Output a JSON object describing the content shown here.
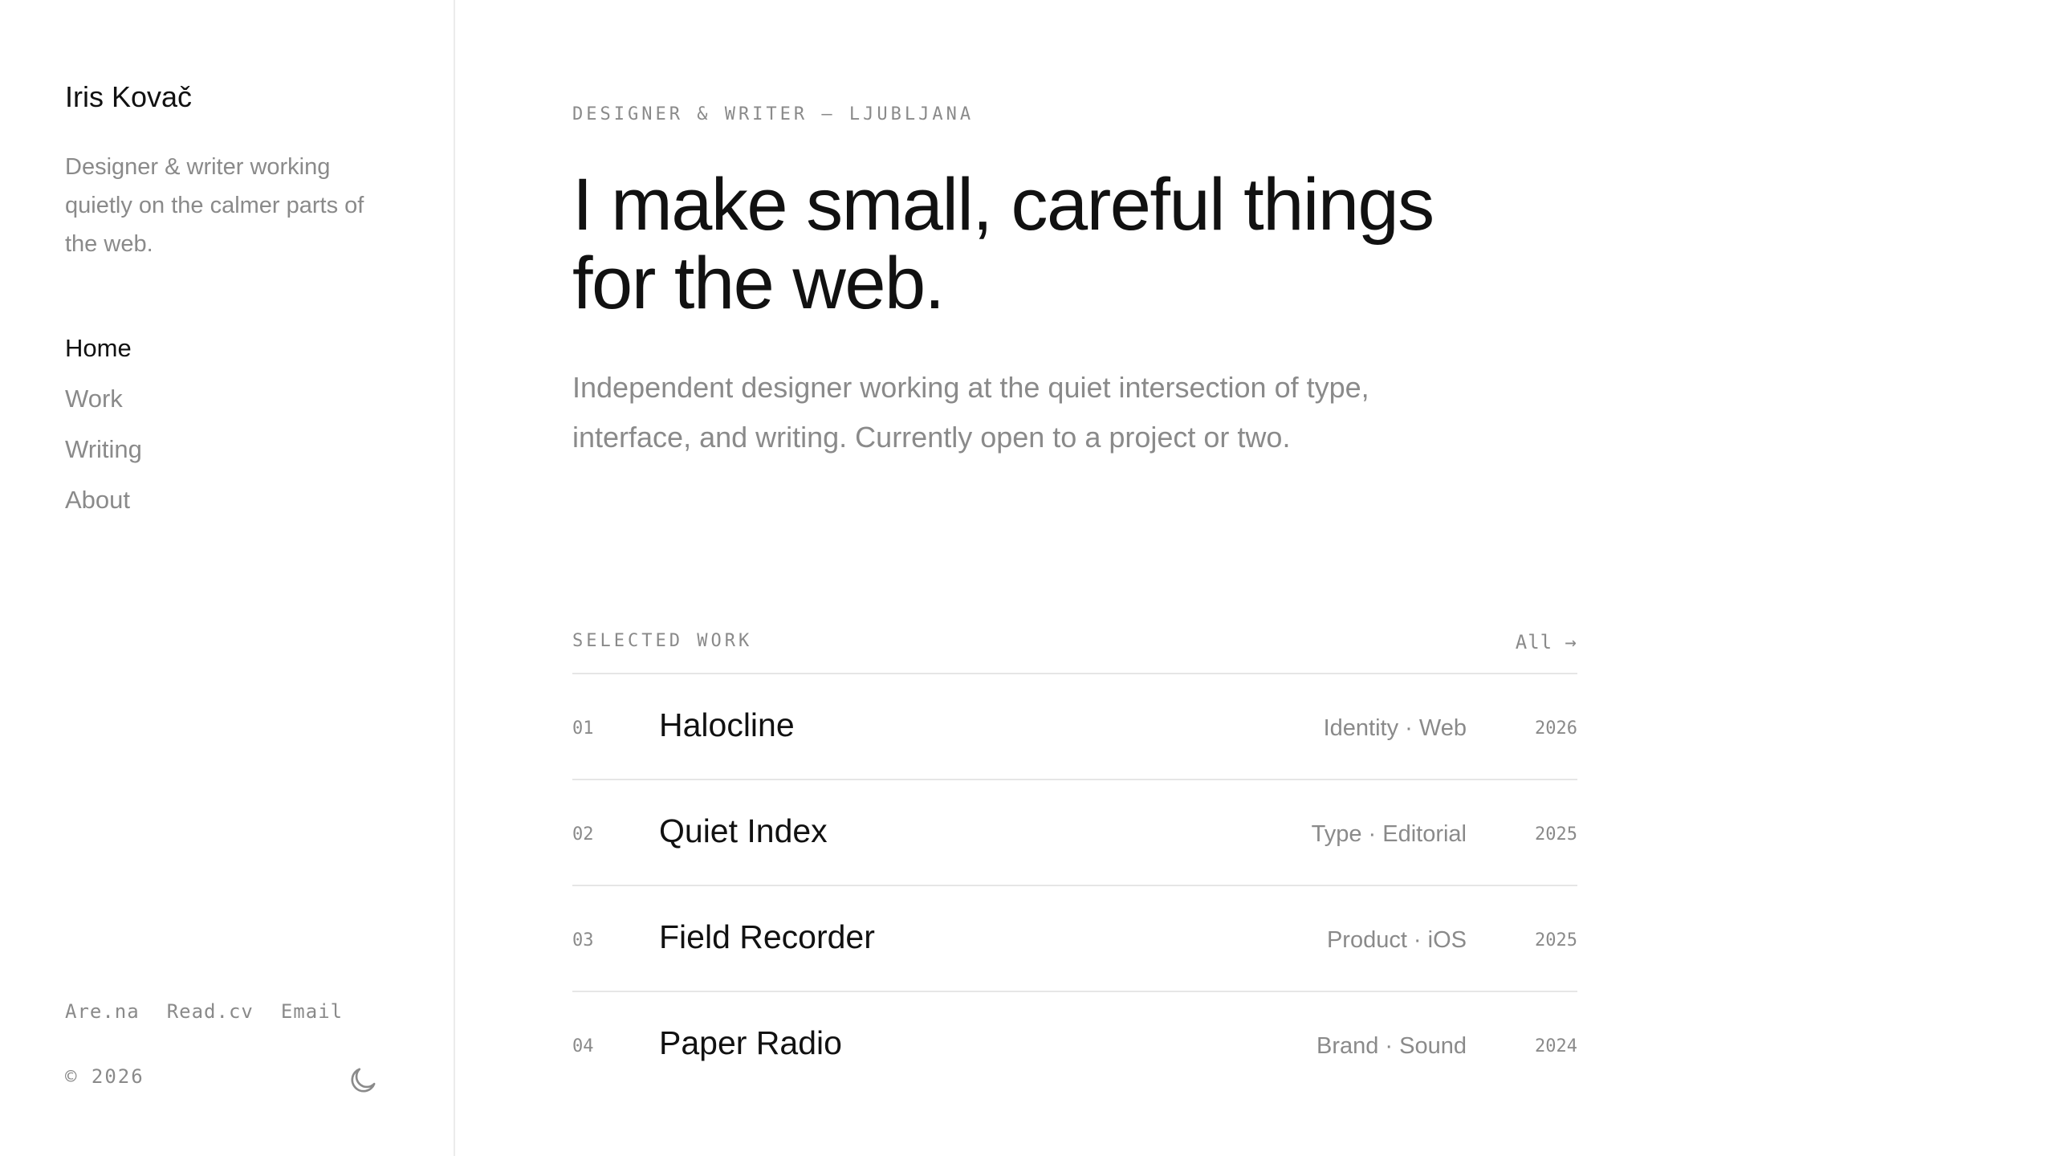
{
  "sidebar": {
    "name": "Iris Kovač",
    "tagline": "Designer & writer working quietly on the calmer parts of the web.",
    "nav": [
      {
        "label": "Home",
        "active": true
      },
      {
        "label": "Work",
        "active": false
      },
      {
        "label": "Writing",
        "active": false
      },
      {
        "label": "About",
        "active": false
      }
    ],
    "social": [
      "Are.na",
      "Read.cv",
      "Email"
    ],
    "copyright": "© 2026",
    "theme_icon": "moon-icon"
  },
  "hero": {
    "eyebrow": "DESIGNER & WRITER — LJUBLJANA",
    "headline": "I make small, careful things for the web.",
    "lead": "Independent designer working at the quiet intersection of type, interface, and writing. Currently open to a project or two."
  },
  "work": {
    "title": "SELECTED WORK",
    "all_link": "All →",
    "items": [
      {
        "num": "01",
        "title": "Halocline",
        "tags": "Identity · Web",
        "year": "2026"
      },
      {
        "num": "02",
        "title": "Quiet Index",
        "tags": "Type · Editorial",
        "year": "2025"
      },
      {
        "num": "03",
        "title": "Field Recorder",
        "tags": "Product · iOS",
        "year": "2025"
      },
      {
        "num": "04",
        "title": "Paper Radio",
        "tags": "Brand · Sound",
        "year": "2024"
      }
    ]
  },
  "colors": {
    "text": "#111111",
    "muted": "#8a8a8a",
    "divider": "#e6e6e6",
    "background": "#ffffff"
  }
}
